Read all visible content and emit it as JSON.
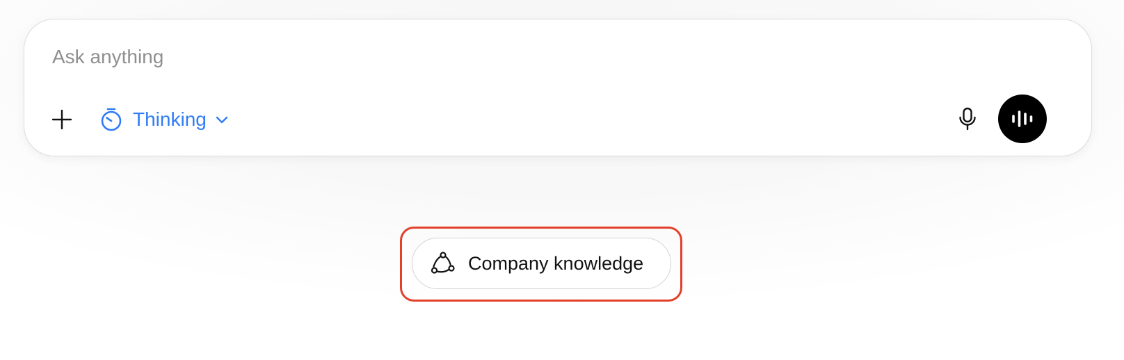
{
  "composer": {
    "placeholder": "Ask anything",
    "mode": {
      "label": "Thinking",
      "icon": "stopwatch-icon",
      "color": "#2f7cf6"
    },
    "buttons": {
      "attach_icon": "plus-icon",
      "dictate_icon": "microphone-icon",
      "voice_mode_icon": "audio-waveform-icon",
      "voice_button_color": "#000000"
    }
  },
  "suggestion": {
    "label": "Company knowledge",
    "icon": "connected-nodes-icon",
    "highlight_color": "#e2402a"
  }
}
